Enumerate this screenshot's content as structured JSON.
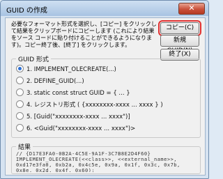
{
  "window": {
    "title": "GUID の作成",
    "close_glyph": "✕"
  },
  "description": "必要なフォーマット形式を選択し、[コピー] をクリックして結果をクリップボードにコピーします (これにより結果をソース コードに貼り付けることができるようになります)。コピー終了後、[終了] をクリックします。",
  "buttons": {
    "copy": "コピー(C)",
    "new_guid": "新規 GUID(N)",
    "exit": "終了(X)"
  },
  "guid_format": {
    "label": "GUID 形式",
    "options": [
      {
        "label": "1. IMPLEMENT_OLECREATE(...)",
        "selected": true
      },
      {
        "label": "2. DEFINE_GUID(...)",
        "selected": false
      },
      {
        "label": "3. static const struct GUID = { ... }",
        "selected": false
      },
      {
        "label": "4. レジストリ形式 ( {xxxxxxxx-xxxx ... xxxx } )",
        "selected": false
      },
      {
        "label": "5. [Guid(\"xxxxxxxx-xxxx ... xxxx\")]",
        "selected": false
      },
      {
        "label": "6. <Guid(\"xxxxxxxx-xxxx ... xxxx\")>",
        "selected": false
      }
    ]
  },
  "result": {
    "label": "結果",
    "text": "// {D17E3FA0-0B2A-4C5E-9A1F-3C7B8E2D4F60} IMPLEMENT_OLECREATE(<<class>>, <<external_name>>, 0xd17e3fa0, 0xb2a, 0x4c5e, 0x9a, 0x1f, 0x3c, 0x7b, 0x8e, 0x2d, 0x4f, 0x60);"
  }
}
